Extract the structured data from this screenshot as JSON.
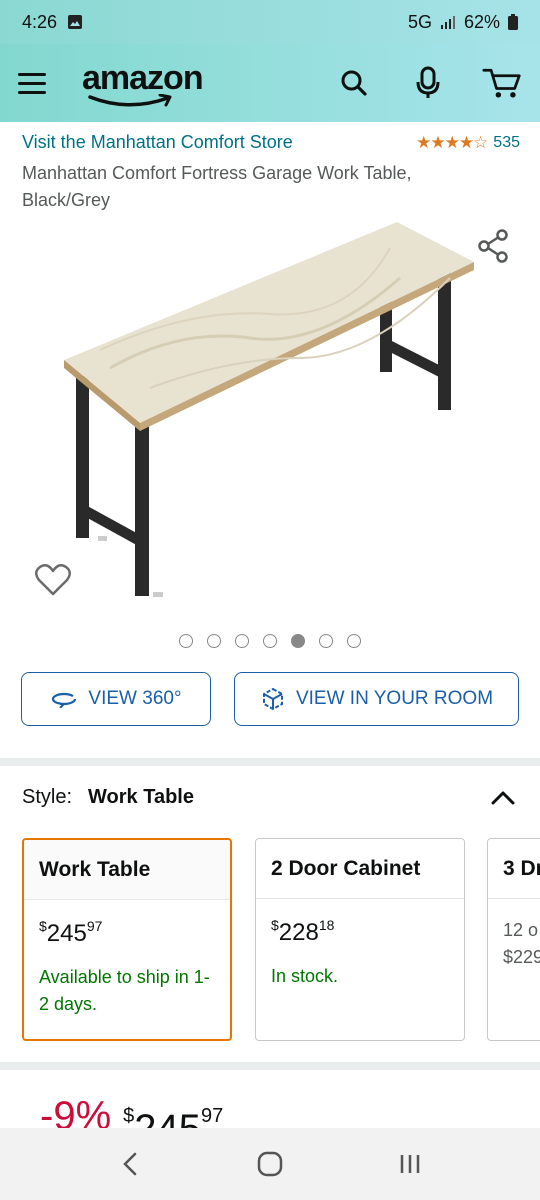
{
  "status": {
    "time": "4:26",
    "network": "5G",
    "battery": "62%"
  },
  "header": {
    "logo": "amazon"
  },
  "store": {
    "link": "Visit the Manhattan Comfort Store",
    "stars": "★★★★☆",
    "rating_count": "535",
    "rating_value": 4.5
  },
  "product": {
    "title": "Manhattan Comfort Fortress Garage Work Table, Black/Grey"
  },
  "gallery": {
    "dot_count": 7,
    "active_index": 4
  },
  "buttons": {
    "view_360": "VIEW 360°",
    "view_room": "VIEW IN YOUR ROOM"
  },
  "style": {
    "label": "Style:",
    "value": "Work Table",
    "options": [
      {
        "name": "Work Table",
        "price_dollar": "$",
        "price_whole": "245",
        "price_cents": "97",
        "availability": "Available to ship in 1-2 days.",
        "selected": true
      },
      {
        "name": "2 Door Cabinet",
        "price_dollar": "$",
        "price_whole": "228",
        "price_cents": "18",
        "availability": "In stock.",
        "selected": false
      },
      {
        "name": "3 Dr",
        "line1": "12 o",
        "line2": "$229",
        "selected": false
      }
    ]
  },
  "price": {
    "discount": "-9%",
    "dollar": "$",
    "whole": "245",
    "cents": "97"
  },
  "colors": {
    "link": "#007185",
    "star": "#de7921",
    "stock": "#007600",
    "selected_border": "#e77600",
    "discount": "#cc0c39",
    "button": "#1a5fa8"
  }
}
